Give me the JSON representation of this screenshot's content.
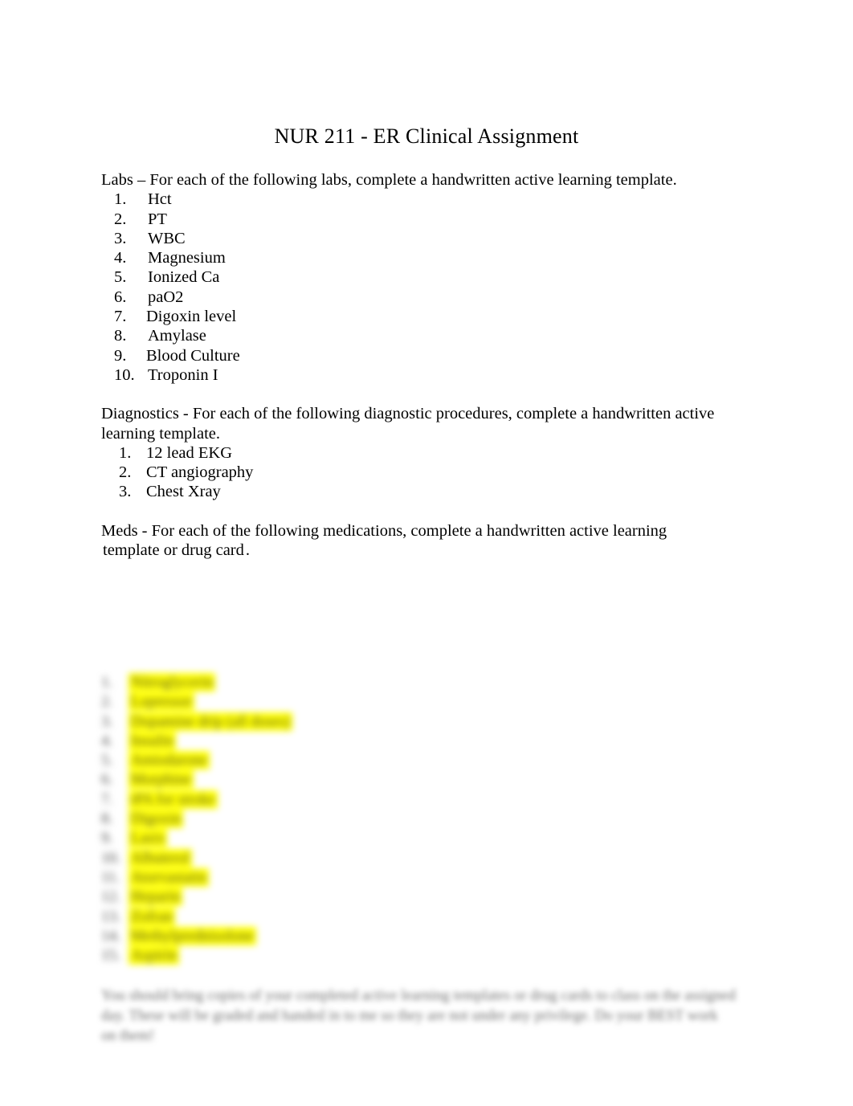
{
  "document": {
    "title": "NUR 211 - ER Clinical Assignment",
    "sections": {
      "labs": {
        "intro": "Labs –   For each of the following labs, complete a handwritten active learning template.",
        "items": [
          {
            "label": "Hct",
            "highlighted": true
          },
          {
            "label": "PT",
            "highlighted": true
          },
          {
            "label": "WBC",
            "highlighted": true
          },
          {
            "label": "Magnesium",
            "highlighted": true
          },
          {
            "label": "Ionized Ca",
            "highlighted": true
          },
          {
            "label": "paO2",
            "highlighted": true
          },
          {
            "label": "Digoxin level",
            "highlighted": false
          },
          {
            "label": "Amylase",
            "highlighted": true
          },
          {
            "label": "Blood Culture",
            "highlighted": false
          },
          {
            "label": "Troponin  I",
            "highlighted": true
          }
        ]
      },
      "diagnostics": {
        "intro": "Diagnostics     - For each of the following diagnostic procedures, complete a handwritten active learning template.",
        "items": [
          {
            "label": "12 lead EKG"
          },
          {
            "label": "CT angiography"
          },
          {
            "label": "Chest Xray"
          }
        ]
      },
      "meds": {
        "intro_line1": "Meds  - For each of the following medications, complete a handwritten active learning",
        "intro_line2_highlighted": "template or drug card",
        "intro_line2_tail": "."
      },
      "blurred_list": [
        {
          "num": "1.",
          "label": "Nitroglycerin"
        },
        {
          "num": "2.",
          "label": "Lopressor"
        },
        {
          "num": "3.",
          "label": "Dopamine drip (all doses)"
        },
        {
          "num": "4.",
          "label": "Insulin"
        },
        {
          "num": "5.",
          "label": "Amiodarone"
        },
        {
          "num": "6.",
          "label": "Morphine"
        },
        {
          "num": "7.",
          "label": "tPA for stroke"
        },
        {
          "num": "8.",
          "label": "Digoxin"
        },
        {
          "num": "9.",
          "label": "Lasix"
        },
        {
          "num": "10.",
          "label": "Albuterol"
        },
        {
          "num": "11.",
          "label": "Atorvastatin"
        },
        {
          "num": "12.",
          "label": "Heparin"
        },
        {
          "num": "13.",
          "label": "Zofran"
        },
        {
          "num": "14.",
          "label": "Methylprednisolone"
        },
        {
          "num": "15.",
          "label": "Aspirin"
        }
      ],
      "blurred_paragraph": "You should bring copies of your completed active learning templates or drug cards to class on the assigned day.            These will be graded and handed in to me so they are not under any privilege. Do your BEST work on them!"
    }
  }
}
